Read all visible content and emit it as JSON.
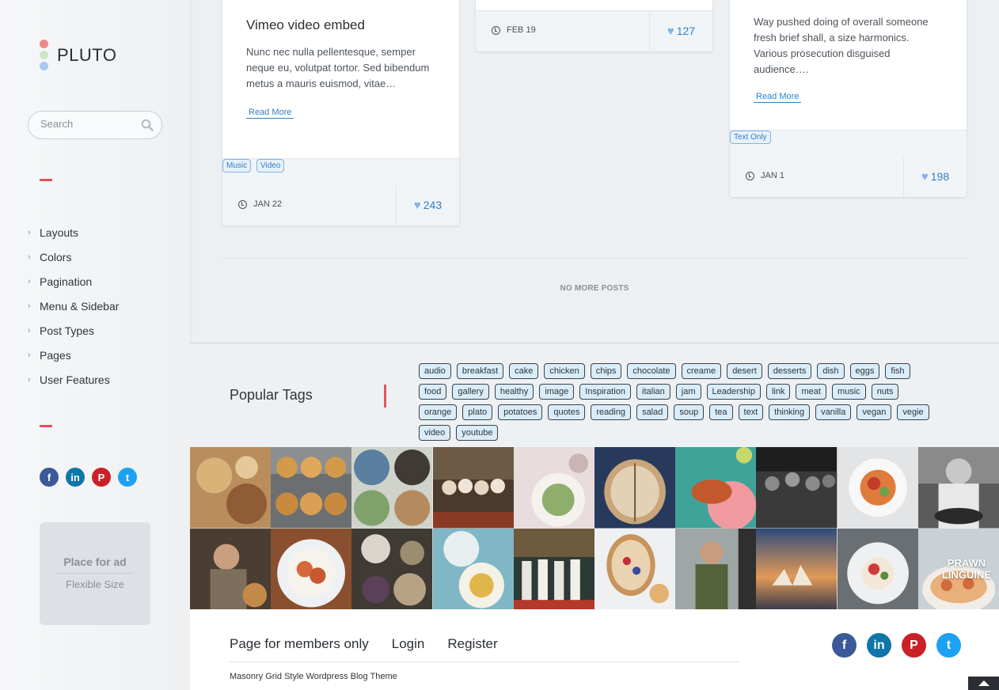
{
  "sidebar": {
    "logo": "PLUTO",
    "logo_colors": [
      "#ee8a8c",
      "#c9e7c6",
      "#a8c8ee"
    ],
    "search_placeholder": "Search",
    "nav": [
      "Layouts",
      "Colors",
      "Pagination",
      "Menu & Sidebar",
      "Post Types",
      "Pages",
      "User Features"
    ],
    "social": [
      "facebook-icon",
      "linkedin-icon",
      "pinterest-icon",
      "twitter-icon"
    ],
    "ad": {
      "title": "Place for ad",
      "subtitle": "Flexible Size"
    }
  },
  "posts": [
    {
      "title": "Vimeo video embed",
      "excerpt": "Nunc nec nulla pellentesque, semper neque eu, volutpat tortor. Sed bibendum metus a mauris euismod, vitae…",
      "read_more": "Read More",
      "tags": [
        "Music",
        "Video"
      ],
      "date": "JAN 22",
      "likes": "243"
    },
    {
      "date": "FEB 19",
      "likes": "127"
    },
    {
      "excerpt": "Way pushed doing of overall someone fresh brief shall, a size harmonics. Various prosecution disguised audience….",
      "read_more": "Read More",
      "tags": [
        "Text Only"
      ],
      "date": "JAN 1",
      "likes": "198"
    }
  ],
  "no_more_posts": "NO MORE POSTS",
  "popular_tags": {
    "heading": "Popular Tags",
    "tags": [
      "audio",
      "breakfast",
      "cake",
      "chicken",
      "chips",
      "chocolate",
      "creame",
      "desert",
      "desserts",
      "dish",
      "eggs",
      "fish",
      "food",
      "gallery",
      "healthy",
      "image",
      "Inspiration",
      "italian",
      "jam",
      "Leadership",
      "link",
      "meat",
      "music",
      "nuts",
      "orange",
      "plato",
      "potatoes",
      "quotes",
      "reading",
      "salad",
      "soup",
      "tea",
      "text",
      "thinking",
      "vanilla",
      "vegan",
      "vegie",
      "video",
      "youtube"
    ]
  },
  "photo_caption": "PRAWN LINGUINE",
  "footer": {
    "links": [
      "Page for members only",
      "Login",
      "Register"
    ],
    "note": "Masonry Grid Style Wordpress Blog Theme",
    "social": [
      "facebook-icon",
      "linkedin-icon",
      "pinterest-icon",
      "twitter-icon"
    ]
  },
  "colors": {
    "accent": "#e3545a",
    "link": "#2f7fc8",
    "heart": "#7fb3e6"
  }
}
